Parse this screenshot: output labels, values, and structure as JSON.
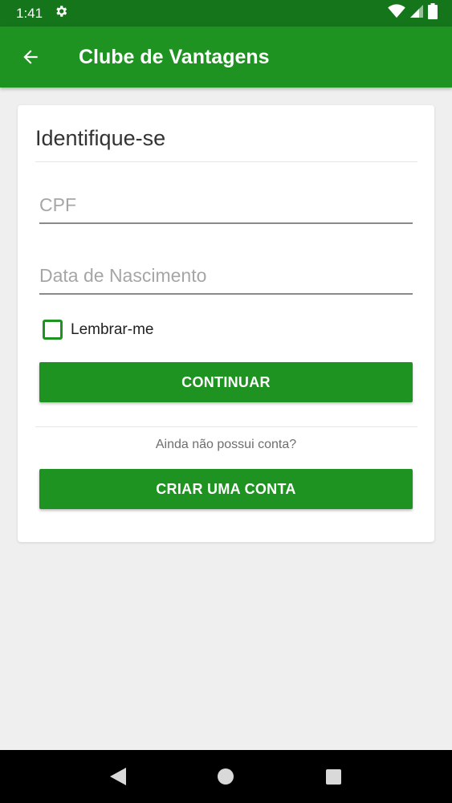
{
  "status_bar": {
    "time": "1:41",
    "icons": [
      "settings-icon",
      "wifi-icon",
      "signal-icon",
      "battery-icon"
    ]
  },
  "app_bar": {
    "title": "Clube de Vantagens",
    "back_icon": "arrow-back-icon"
  },
  "card": {
    "title": "Identifique-se",
    "cpf_placeholder": "CPF",
    "cpf_value": "",
    "birthdate_placeholder": "Data de Nascimento",
    "birthdate_value": "",
    "remember_label": "Lembrar-me",
    "remember_checked": false,
    "continue_label": "CONTINUAR",
    "no_account_text": "Ainda não possui conta?",
    "create_account_label": "CRIAR UMA CONTA"
  },
  "nav_bar": {
    "buttons": [
      "back-triangle-icon",
      "home-circle-icon",
      "recents-square-icon"
    ]
  },
  "colors": {
    "status_bar": "#15751a",
    "app_bar": "#1f9321",
    "accent": "#1f9321",
    "background": "#efefef"
  }
}
